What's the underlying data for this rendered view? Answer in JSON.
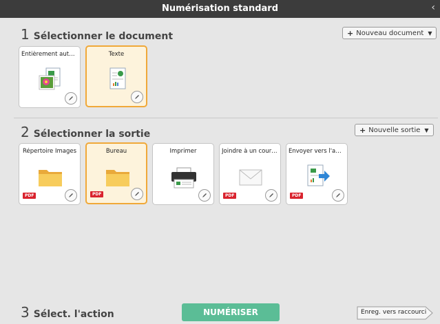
{
  "window": {
    "title": "Numérisation standard",
    "collapse_glyph": "‹"
  },
  "step1": {
    "number": "1",
    "title": "Sélectionner le document",
    "new_button": {
      "label": "Nouveau document",
      "icon": "plus-icon"
    },
    "cards": [
      {
        "label": "Entièrement auto...",
        "icon": "photo-document-icon",
        "selected": false
      },
      {
        "label": "Texte",
        "icon": "text-document-icon",
        "selected": true
      }
    ]
  },
  "step2": {
    "number": "2",
    "title": "Sélectionner la sortie",
    "new_button": {
      "label": "Nouvelle sortie",
      "icon": "plus-icon"
    },
    "cards": [
      {
        "label": "Répertoire Images",
        "icon": "folder-icon",
        "selected": false,
        "badge": "PDF"
      },
      {
        "label": "Bureau",
        "icon": "folder-icon",
        "selected": true,
        "badge": "PDF"
      },
      {
        "label": "Imprimer",
        "icon": "printer-icon",
        "selected": false,
        "badge": ""
      },
      {
        "label": "Joindre à un courriel",
        "icon": "envelope-icon",
        "selected": false,
        "badge": "PDF"
      },
      {
        "label": "Envoyer vers l'appl...",
        "icon": "send-to-app-icon",
        "selected": false,
        "badge": "PDF"
      }
    ]
  },
  "step3": {
    "number": "3",
    "title": "Sélect. l'action",
    "scan_button": "NUMÉRISER",
    "shortcut_button": "Enreg. vers raccourci"
  },
  "colors": {
    "titlebar": "#3c3c3c",
    "background": "#e6e6e6",
    "selected_border": "#f0a838",
    "selected_fill": "#fdf3dc",
    "scan_button": "#5bbd96",
    "pdf_badge": "#d9232e"
  }
}
